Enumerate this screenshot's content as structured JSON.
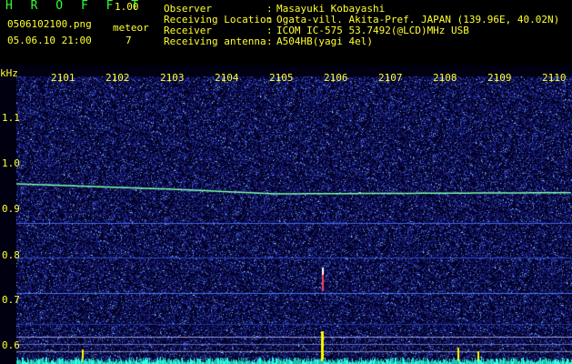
{
  "header": {
    "app_name": "H R O F F T",
    "version": "1.00",
    "filename": "0506102100.png",
    "datetime": "05.06.10 21:00",
    "meteor_label": "meteor",
    "meteor_count": "7"
  },
  "info": [
    {
      "label": "Observer",
      "value": "Masayuki Kobayashi"
    },
    {
      "label": "Receiving Location",
      "value": "Ogata-vill. Akita-Pref. JAPAN (139.96E, 40.02N)"
    },
    {
      "label": "Receiver",
      "value": "ICOM IC-575 53.7492(@LCD)MHz USB"
    },
    {
      "label": "Receiving antenna",
      "value": "A504HB(yagi 4el)"
    }
  ],
  "axis": {
    "unit": "kHz",
    "y_ticks": [
      "1.1",
      "1.0",
      "0.9",
      "0.8",
      "0.7",
      "0.6"
    ],
    "x_ticks": [
      "2101",
      "2102",
      "2103",
      "2104",
      "2105",
      "2106",
      "2107",
      "2108",
      "2109",
      "2110"
    ]
  },
  "colors": {
    "background": "#000000",
    "label_green": "#33ff33",
    "label_yellow": "#ffff33",
    "noise_base": "#0a0a5a",
    "signal_trace": "#80ffb0"
  }
}
